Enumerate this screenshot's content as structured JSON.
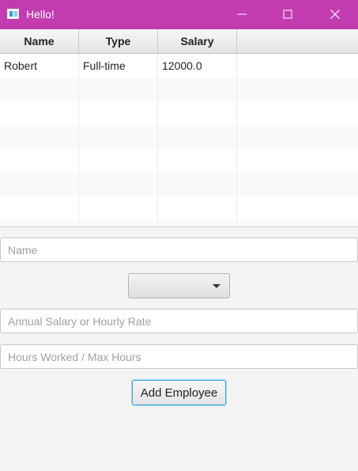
{
  "window": {
    "title": "Hello!",
    "accent_color": "#c23cb0",
    "buttons": {
      "minimize_icon": "minimize-icon",
      "maximize_icon": "maximize-icon",
      "close_icon": "close-icon"
    }
  },
  "table": {
    "columns": [
      "Name",
      "Type",
      "Salary"
    ],
    "rows": [
      [
        "Robert",
        "Full-time",
        "12000.0"
      ]
    ]
  },
  "form": {
    "name_placeholder": "Name",
    "type_selected": "",
    "salary_placeholder": "Annual Salary or Hourly Rate",
    "hours_placeholder": "Hours Worked / Max Hours",
    "add_button_label": "Add Employee"
  }
}
